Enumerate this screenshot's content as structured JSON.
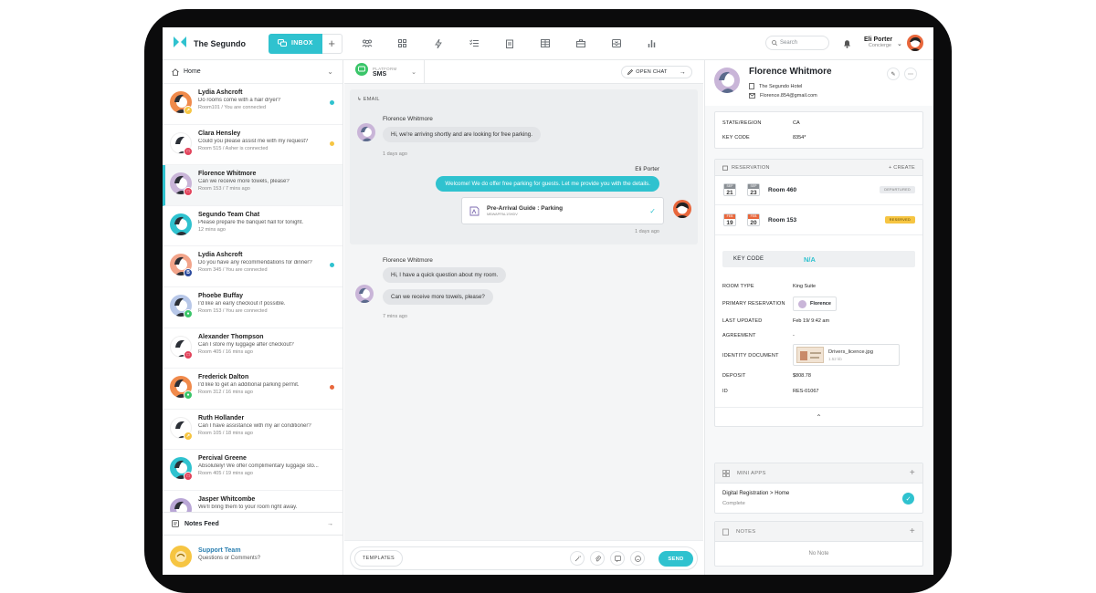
{
  "app": {
    "name": "The Segundo",
    "accent": "#2fc2cf"
  },
  "topbar": {
    "inbox_label": "INBOX",
    "add_label": "+",
    "nav_icons": [
      "team-icon",
      "grid-icon",
      "bolt-icon",
      "checklist-icon",
      "clipboard-icon",
      "table-icon",
      "briefcase-icon",
      "inbox-tray-icon",
      "chart-icon"
    ],
    "search_placeholder": "Search",
    "user_name": "Eli Porter",
    "user_role": "Concierge"
  },
  "left": {
    "home_label": "Home",
    "conversations": [
      {
        "name": "Lydia Ashcroft",
        "preview": "Do rooms come with a hair dryer?",
        "meta": "Room101 / You are connected",
        "badge_color": "#f6c542",
        "badge_text": "↗",
        "dot_color": "#2fc2cf",
        "avatar_bg": "#f08a4b"
      },
      {
        "name": "Clara Hensley",
        "preview": "Could you please assist me with my request?",
        "meta": "Room 515 / Asher is connected",
        "badge_color": "#e2445c",
        "badge_text": "□",
        "dot_color": "#f6c542",
        "avatar_bg": "#ffffff"
      },
      {
        "name": "Florence Whitmore",
        "preview": "Can we receive more towels, please?",
        "meta": "Room 153 / 7 mins ago",
        "badge_color": "#e2445c",
        "badge_text": "□",
        "dot_color": "",
        "avatar_bg": "#c9b5d8"
      },
      {
        "name": "Segundo Team Chat",
        "preview": "Please prepare the banquet hall for tonight.",
        "meta": "12 mins ago",
        "badge_color": "",
        "badge_text": "",
        "dot_color": "",
        "avatar_bg": "#2fc2cf"
      },
      {
        "name": "Lydia Ashcroft",
        "preview": "Do you have any recommendations for dinner?",
        "meta": "Room 345 / You are connected",
        "badge_color": "#2b4a9e",
        "badge_text": "B",
        "dot_color": "#2fc2cf",
        "avatar_bg": "#f2a48a"
      },
      {
        "name": "Phoebe Buffay",
        "preview": "I'd like an early checkout if possible.",
        "meta": "Room 153 / You are connected",
        "badge_color": "#3ac569",
        "badge_text": "●",
        "dot_color": "",
        "avatar_bg": "#b7c7e8"
      },
      {
        "name": "Alexander Thompson",
        "preview": "Can I store my luggage after checkout?",
        "meta": "Room 405 / 16 mins ago",
        "badge_color": "#e2445c",
        "badge_text": "□",
        "dot_color": "",
        "avatar_bg": "#ffffff"
      },
      {
        "name": "Frederick Dalton",
        "preview": "I'd like to get an additional parking permit.",
        "meta": "Room 312 / 16 mins ago",
        "badge_color": "#3ac569",
        "badge_text": "●",
        "dot_color": "#e8673c",
        "avatar_bg": "#f08a4b"
      },
      {
        "name": "Ruth Hollander",
        "preview": "Can I have assistance with my air conditioner?",
        "meta": "Room 105 / 18 mins ago",
        "badge_color": "#f6c542",
        "badge_text": "↗",
        "dot_color": "",
        "avatar_bg": "#ffffff"
      },
      {
        "name": "Percival Greene",
        "preview": "Absolutely! We offer complimentary luggage sto...",
        "meta": "Room 405 / 19 mins ago",
        "badge_color": "#e2445c",
        "badge_text": "□",
        "dot_color": "",
        "avatar_bg": "#2fc2cf"
      },
      {
        "name": "Jasper Whitcombe",
        "preview": "We'll bring them to your room right away.",
        "meta": "",
        "badge_color": "",
        "badge_text": "",
        "dot_color": "",
        "avatar_bg": "#b9a6d6"
      }
    ],
    "notes_feed_label": "Notes Feed",
    "support": {
      "name": "Support Team",
      "subtitle": "Questions or Comments?"
    }
  },
  "center": {
    "platform_label": "PLATFORM",
    "platform_value": "SMS",
    "open_chat_label": "OPEN CHAT",
    "email_tag": "EMAIL",
    "thread1": {
      "sender": "Florence Whitmore",
      "message": "Hi, we're arriving shortly and are looking for free parking.",
      "time": "1 days ago",
      "reply_sender": "Eli Porter",
      "reply": "Welcome! We do offer free parking for guests. Let me provide you with the details.",
      "guide_title": "Pre-Arrival Guide : Parking",
      "guide_sub": "MBWAPPAL1SHDV",
      "reply_time": "1 days ago"
    },
    "thread2": {
      "sender": "Florence Whitmore",
      "messages": [
        "Hi, I have a quick question about my room.",
        "Can we receive more towels, please?"
      ],
      "time": "7 mins ago"
    },
    "templates_label": "TEMPLATES",
    "send_label": "SEND"
  },
  "right": {
    "name": "Florence Whitmore",
    "hotel": "The Segundo Hotel",
    "email": "Florence.854@gmail.com",
    "state_label": "STATE/REGION",
    "state_value": "CA",
    "keycode_label": "KEY CODE",
    "keycode_value": "8354*",
    "reservation_label": "RESERVATION",
    "create_label": "+ CREATE",
    "reservations": [
      {
        "m1": "SEP",
        "d1": "21",
        "m2": "SEP",
        "d2": "23",
        "room": "Room 460",
        "status": "DEPARTURED",
        "status_bg": "#e9ebee",
        "status_fg": "#777",
        "month_color": "#8a8f94"
      },
      {
        "m1": "FEB",
        "d1": "19",
        "m2": "FEB",
        "d2": "20",
        "room": "Room 153",
        "status": "RESERVED",
        "status_bg": "#f6c542",
        "status_fg": "#5a4300",
        "month_color": "#e8673c"
      }
    ],
    "detail": {
      "key_code_label": "KEY CODE",
      "key_code_value": "N/A",
      "room_type_label": "ROOM TYPE",
      "room_type_value": "King Suite",
      "primary_label": "PRIMARY RESERVATION",
      "primary_value": "Florence",
      "updated_label": "LAST UPDATED",
      "updated_value": "Feb 19/ 9:42 am",
      "agreement_label": "AGREEMENT",
      "agreement_value": "-",
      "identity_label": "IDENTITY DOCUMENT",
      "identity_file": "Drivers_licence.jpg",
      "identity_size": "1.52 kb",
      "deposit_label": "DEPOSIT",
      "deposit_value": "$808.78",
      "id_label": "ID",
      "id_value": "RES-01067"
    },
    "mini_apps_label": "MINI APPS",
    "mini_app": {
      "title": "Digital Registration > Home",
      "status": "Complete"
    },
    "notes_label": "NOTES",
    "no_note": "No Note"
  }
}
